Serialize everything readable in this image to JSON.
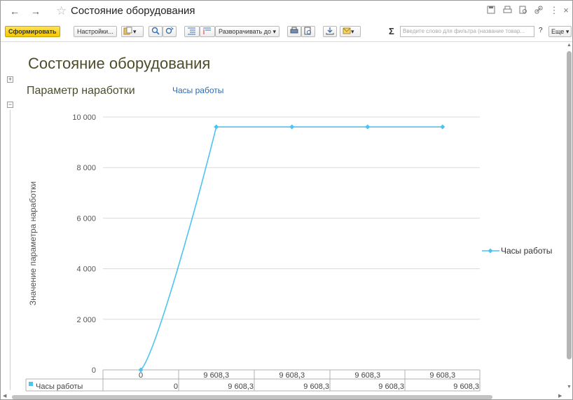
{
  "window": {
    "title": "Состояние оборудования",
    "back_icon": "←",
    "forward_icon": "→",
    "star_icon": "☆",
    "close_icon": "×"
  },
  "toolbar": {
    "generate": "Сформировать",
    "settings": "Настройки...",
    "expand_to": "Разворачивать до",
    "search_placeholder": "Введите слово для фильтра (название товар...",
    "help": "?",
    "more": "Еще",
    "dropdown_glyph": "▾"
  },
  "report": {
    "title": "Состояние оборудования",
    "param_label": "Параметр наработки",
    "param_value": "Часы работы"
  },
  "chart_data": {
    "type": "line",
    "categories": [
      "",
      "",
      "",
      "",
      ""
    ],
    "series": [
      {
        "name": "Часы работы",
        "values": [
          0,
          9608.3,
          9608.3,
          9608.3,
          9608.3
        ],
        "color": "#4cc3f0"
      }
    ],
    "point_labels": [
      "0",
      "9 608,3",
      "9 608,3",
      "9 608,3",
      "9 608,3"
    ],
    "ylabel": "Значение параметра наработки",
    "ylim": [
      0,
      10000
    ],
    "yticks": [
      0,
      2000,
      4000,
      6000,
      8000,
      10000
    ],
    "ytick_labels": [
      "0",
      "2 000",
      "4 000",
      "6 000",
      "8 000",
      "10 000"
    ],
    "grid": true,
    "legend": "right",
    "table": {
      "row_label": "Часы работы",
      "values": [
        "0",
        "9 608,3",
        "9 608,3",
        "9 608,3",
        "9 608,3"
      ]
    }
  }
}
